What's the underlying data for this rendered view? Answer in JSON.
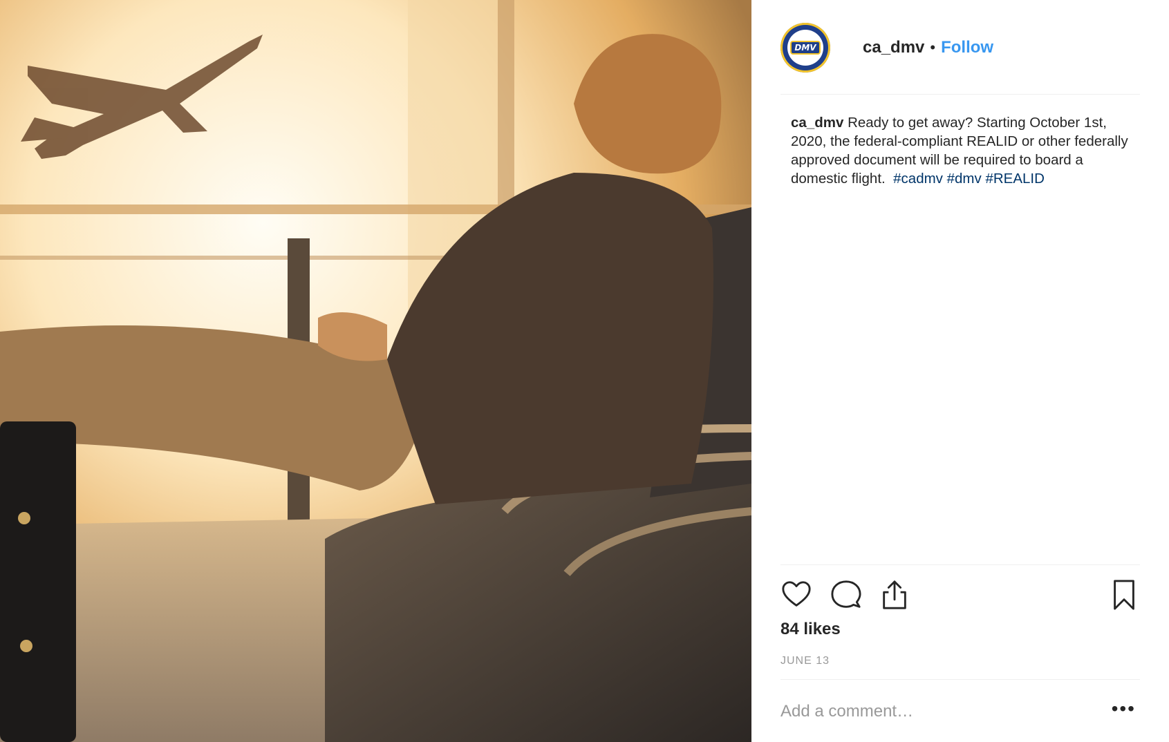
{
  "post": {
    "image_alt": "",
    "header": {
      "username": "ca_dmv",
      "separator": "•",
      "follow_label": "Follow",
      "avatar_badge_text": "DMV"
    },
    "caption": {
      "username": "ca_dmv",
      "text": "Ready to get away? Starting October 1st, 2020, the federal-compliant REALID or other federally approved document will be required to board a domestic flight.",
      "hashtags": [
        "#cadmv",
        "#dmv",
        "#REALID"
      ]
    },
    "actions": {
      "like_icon": "heart-icon",
      "comment_icon": "speech-bubble-icon",
      "share_icon": "share-icon",
      "save_icon": "bookmark-icon"
    },
    "likes_label": "84 likes",
    "date_label": "JUNE 13",
    "comment_box": {
      "placeholder": "Add a comment…",
      "more_label": "•••"
    },
    "colors": {
      "follow": "#3897f0",
      "hashtag": "#003569",
      "muted": "#999999",
      "text": "#262626"
    }
  }
}
